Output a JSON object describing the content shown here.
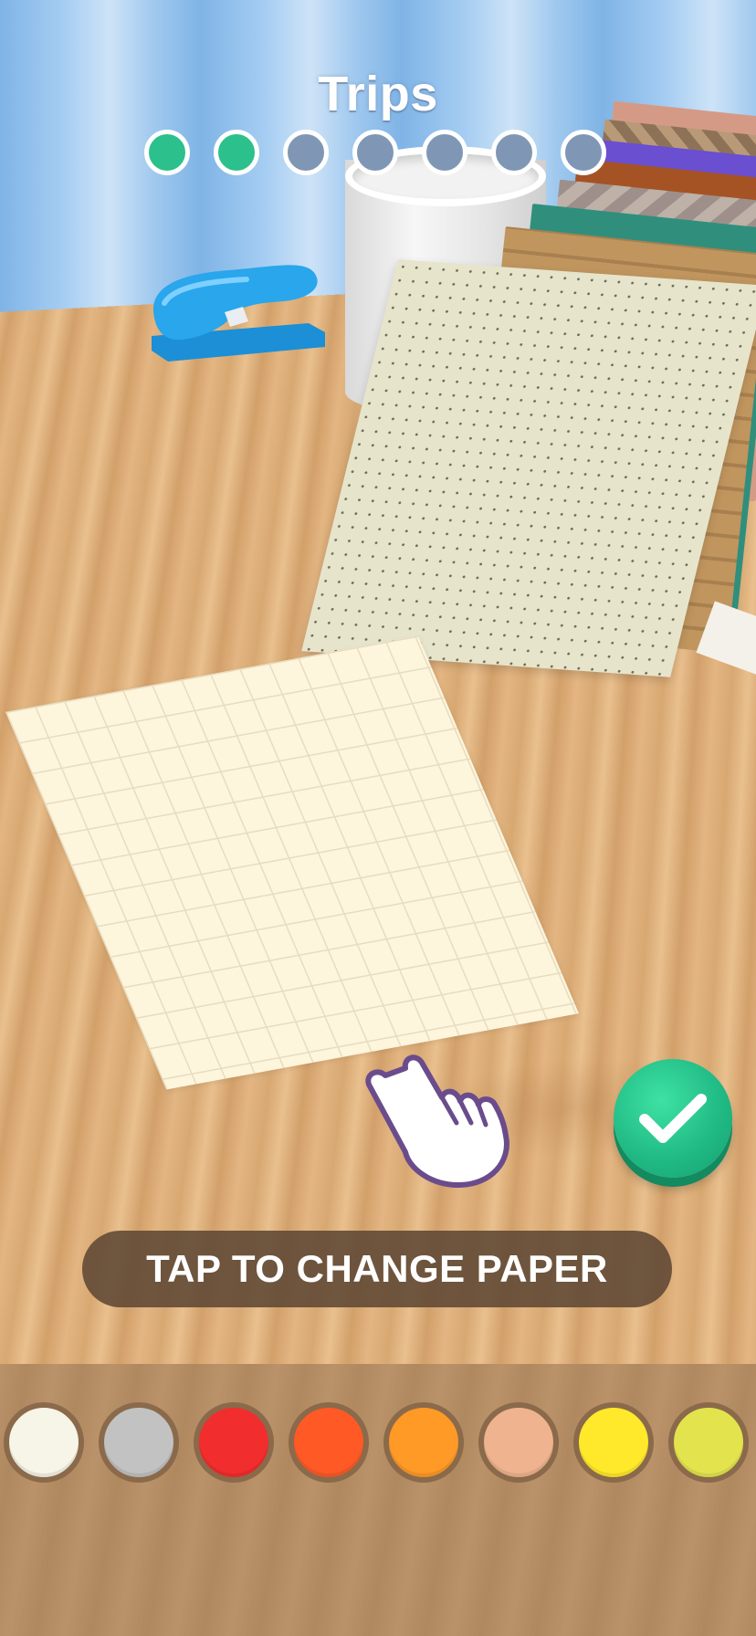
{
  "header": {
    "level_title": "Trips",
    "progress": {
      "total": 7,
      "completed": 2
    }
  },
  "hint": {
    "text": "TAP TO CHANGE PAPER"
  },
  "confirm": {
    "icon": "checkmark-icon",
    "color": "#22c08c"
  },
  "pointer": {
    "icon": "tap-hand-icon"
  },
  "palette": {
    "colors": [
      "#f7f4e8",
      "#c2c2c2",
      "#f22d2d",
      "#ff5a26",
      "#ff9a26",
      "#efb38f",
      "#ffe92a",
      "#e3e44d"
    ]
  },
  "paper_stack": {
    "top_sheet": "dotted",
    "sheet_colors": [
      "#d59a86",
      "#b99a78",
      "#6a4fd0",
      "#a55325",
      "#9f8f8a",
      "#2f8f7c",
      "#c0955e",
      "#e7e4cc"
    ]
  },
  "grid_paper": {
    "color": "#fdf5dc",
    "line_color": "#e6dcc0"
  }
}
